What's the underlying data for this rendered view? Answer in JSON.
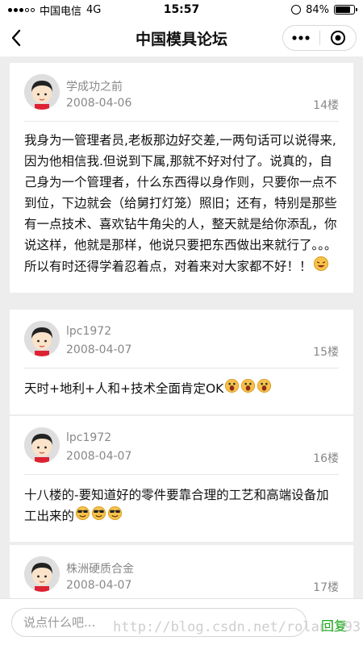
{
  "status_bar": {
    "carrier": "中国电信",
    "network": "4G",
    "time": "15:57",
    "battery": "84%",
    "battery_level": 0.84
  },
  "nav": {
    "title": "中国模具论坛",
    "icons": {
      "back": "chevron-left-icon",
      "more": "more-dots-icon",
      "close": "target-close-icon"
    }
  },
  "posts": [
    {
      "author": "学成功之前",
      "date": "2008-04-06",
      "floor": "14楼",
      "content": "我身为一管理者员,老板那边好交差,一两句话可以说得来,因为他相信我.但说到下属,那就不好对付了。说真的，自己身为一个管理者，什么东西得以身作则，只要你一点不到位，下边就会（给舅打灯笼）照旧；还有，特别是那些有一点技术、喜欢钻牛角尖的人，整天就是给你添乱，你说这样，他就是那样，他说只要把东西做出来就行了。。。所以有时还得学着忍着点，对着来对大家都不好！！",
      "emojis": [
        "laughing-emoji"
      ]
    },
    {
      "author": "lpc1972",
      "date": "2008-04-07",
      "floor": "15楼",
      "content": "天时+地利+人和+技术全面肯定OK",
      "emojis": [
        "surprised-emoji",
        "surprised-emoji",
        "surprised-emoji"
      ]
    },
    {
      "author": "lpc1972",
      "date": "2008-04-07",
      "floor": "16楼",
      "content": "十八楼的-要知道好的零件要靠合理的工艺和高端设备加工出来的",
      "emojis": [
        "sunglasses-emoji",
        "sunglasses-emoji",
        "sunglasses-emoji"
      ]
    },
    {
      "author": "株洲硬质合金",
      "date": "2008-04-07",
      "floor": "17楼"
    }
  ],
  "bottom": {
    "input_placeholder": "说点什么吧...",
    "reply_label": "回复",
    "watermark": "http://blog.csdn.net/rolan1993"
  },
  "colors": {
    "accent": "#1aad19",
    "meta_text": "#888888",
    "background": "#ededed"
  }
}
